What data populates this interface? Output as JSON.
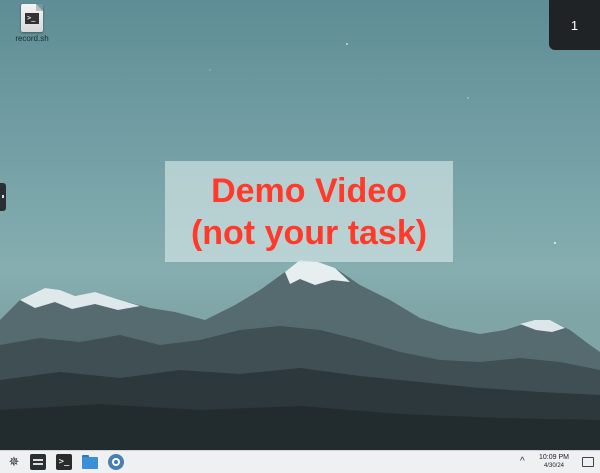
{
  "desktop": {
    "icons": [
      {
        "label": "record.sh",
        "icon": "shell-script-file-icon"
      }
    ]
  },
  "workspace": {
    "number": "1"
  },
  "overlay": {
    "line1": "Demo Video",
    "line2": "(not your task)",
    "text_color": "#ff3a2a"
  },
  "taskbar": {
    "launcher_icon": "application-launcher-icon",
    "apps": [
      {
        "icon": "system-monitor-icon"
      },
      {
        "icon": "terminal-icon",
        "glyph": ">_"
      },
      {
        "icon": "file-manager-icon"
      },
      {
        "icon": "chromium-browser-icon"
      }
    ],
    "tray_arrow": "^",
    "clock": {
      "time": "10:09 PM",
      "date": "4/30/24"
    },
    "show_desktop_icon": "show-desktop-icon"
  }
}
